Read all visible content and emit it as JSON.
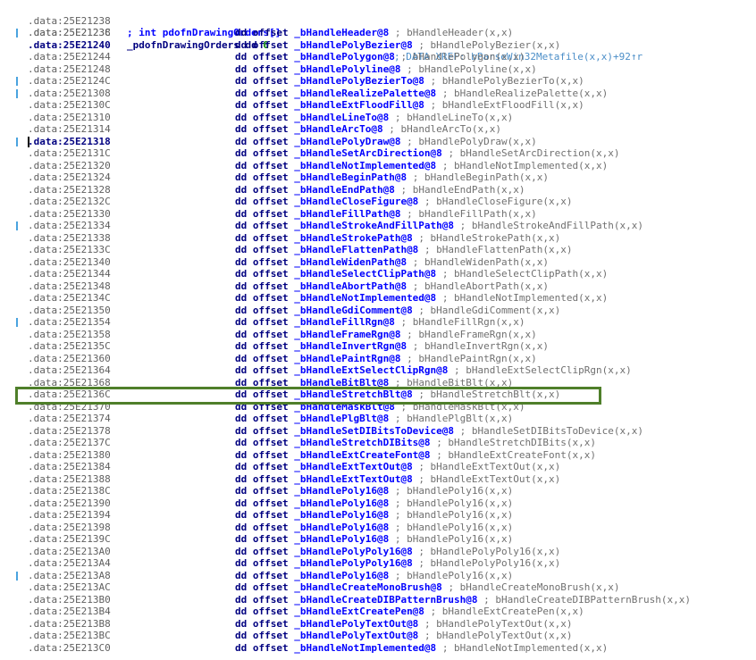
{
  "colors": {
    "address": "#606060",
    "keyword": "#000080",
    "symbol": "#0000ff",
    "comment": "#707070",
    "xref": "#4b8ec8",
    "selection_box": "#4f7f2a",
    "gutter_marker": "#4aa3df"
  },
  "header": {
    "comment_line": {
      "address": ".data:25E21238",
      "text": "; int pdofnDrawingOrders[]"
    },
    "decl_line": {
      "address": ".data:25E21238",
      "name": "_pdofnDrawingOrders",
      "directive": "dd",
      "value": "0",
      "xref": "; DATA XREF: bParseWin32Metafile(x,x)+92↑r"
    }
  },
  "selected_row_address": ".data:25E2136C",
  "rows": [
    {
      "address": ".data:25E2123C",
      "instr": "dd offset",
      "symbol": "_bHandleHeader@8",
      "comment": "; bHandleHeader(x,x)"
    },
    {
      "address": ".data:25E21240",
      "instr": "dd offset",
      "symbol": "_bHandlePolyBezier@8",
      "comment": "; bHandlePolyBezier(x,x)"
    },
    {
      "address": ".data:25E21244",
      "instr": "dd offset",
      "symbol": "_bHandlePolygon@8",
      "comment": "; bHandlePolygon(x,x)"
    },
    {
      "address": ".data:25E21248",
      "instr": "dd offset",
      "symbol": "_bHandlePolyline@8",
      "comment": "; bHandlePolyline(x,x)"
    },
    {
      "address": ".data:25E2124C",
      "instr": "dd offset",
      "symbol": "_bHandlePolyBezierTo@8",
      "comment": "; bHandlePolyBezierTo(x,x)"
    },
    {
      "address": ".data:25E21308",
      "instr": "dd offset",
      "symbol": "_bHandleRealizePalette@8",
      "comment": "; bHandleRealizePalette(x,x)"
    },
    {
      "address": ".data:25E2130C",
      "instr": "dd offset",
      "symbol": "_bHandleExtFloodFill@8",
      "comment": "; bHandleExtFloodFill(x,x)"
    },
    {
      "address": ".data:25E21310",
      "instr": "dd offset",
      "symbol": "_bHandleLineTo@8",
      "comment": "; bHandleLineTo(x,x)"
    },
    {
      "address": ".data:25E21314",
      "instr": "dd offset",
      "symbol": "_bHandleArcTo@8",
      "comment": "; bHandleArcTo(x,x)"
    },
    {
      "address": ".data:25E21318",
      "instr": "dd offset",
      "symbol": "_bHandlePolyDraw@8",
      "comment": "; bHandlePolyDraw(x,x)"
    },
    {
      "address": ".data:25E2131C",
      "instr": "dd offset",
      "symbol": "_bHandleSetArcDirection@8",
      "comment": "; bHandleSetArcDirection(x,x)"
    },
    {
      "address": ".data:25E21320",
      "instr": "dd offset",
      "symbol": "_bHandleNotImplemented@8",
      "comment": "; bHandleNotImplemented(x,x)"
    },
    {
      "address": ".data:25E21324",
      "instr": "dd offset",
      "symbol": "_bHandleBeginPath@8",
      "comment": "; bHandleBeginPath(x,x)"
    },
    {
      "address": ".data:25E21328",
      "instr": "dd offset",
      "symbol": "_bHandleEndPath@8",
      "comment": "; bHandleEndPath(x,x)"
    },
    {
      "address": ".data:25E2132C",
      "instr": "dd offset",
      "symbol": "_bHandleCloseFigure@8",
      "comment": "; bHandleCloseFigure(x,x)"
    },
    {
      "address": ".data:25E21330",
      "instr": "dd offset",
      "symbol": "_bHandleFillPath@8",
      "comment": "; bHandleFillPath(x,x)"
    },
    {
      "address": ".data:25E21334",
      "instr": "dd offset",
      "symbol": "_bHandleStrokeAndFillPath@8",
      "comment": "; bHandleStrokeAndFillPath(x,x)"
    },
    {
      "address": ".data:25E21338",
      "instr": "dd offset",
      "symbol": "_bHandleStrokePath@8",
      "comment": "; bHandleStrokePath(x,x)"
    },
    {
      "address": ".data:25E2133C",
      "instr": "dd offset",
      "symbol": "_bHandleFlattenPath@8",
      "comment": "; bHandleFlattenPath(x,x)"
    },
    {
      "address": ".data:25E21340",
      "instr": "dd offset",
      "symbol": "_bHandleWidenPath@8",
      "comment": "; bHandleWidenPath(x,x)"
    },
    {
      "address": ".data:25E21344",
      "instr": "dd offset",
      "symbol": "_bHandleSelectClipPath@8",
      "comment": "; bHandleSelectClipPath(x,x)"
    },
    {
      "address": ".data:25E21348",
      "instr": "dd offset",
      "symbol": "_bHandleAbortPath@8",
      "comment": "; bHandleAbortPath(x,x)"
    },
    {
      "address": ".data:25E2134C",
      "instr": "dd offset",
      "symbol": "_bHandleNotImplemented@8",
      "comment": "; bHandleNotImplemented(x,x)"
    },
    {
      "address": ".data:25E21350",
      "instr": "dd offset",
      "symbol": "_bHandleGdiComment@8",
      "comment": "; bHandleGdiComment(x,x)"
    },
    {
      "address": ".data:25E21354",
      "instr": "dd offset",
      "symbol": "_bHandleFillRgn@8",
      "comment": "; bHandleFillRgn(x,x)"
    },
    {
      "address": ".data:25E21358",
      "instr": "dd offset",
      "symbol": "_bHandleFrameRgn@8",
      "comment": "; bHandleFrameRgn(x,x)"
    },
    {
      "address": ".data:25E2135C",
      "instr": "dd offset",
      "symbol": "_bHandleInvertRgn@8",
      "comment": "; bHandleInvertRgn(x,x)"
    },
    {
      "address": ".data:25E21360",
      "instr": "dd offset",
      "symbol": "_bHandlePaintRgn@8",
      "comment": "; bHandlePaintRgn(x,x)"
    },
    {
      "address": ".data:25E21364",
      "instr": "dd offset",
      "symbol": "_bHandleExtSelectClipRgn@8",
      "comment": "; bHandleExtSelectClipRgn(x,x)"
    },
    {
      "address": ".data:25E21368",
      "instr": "dd offset",
      "symbol": "_bHandleBitBlt@8",
      "comment": "; bHandleBitBlt(x,x)"
    },
    {
      "address": ".data:25E2136C",
      "instr": "dd offset",
      "symbol": "_bHandleStretchBlt@8",
      "comment": "; bHandleStretchBlt(x,x)"
    },
    {
      "address": ".data:25E21370",
      "instr": "dd offset",
      "symbol": "_bHandleMaskBlt@8",
      "comment": "; bHandleMaskBlt(x,x)"
    },
    {
      "address": ".data:25E21374",
      "instr": "dd offset",
      "symbol": "_bHandlePlgBlt@8",
      "comment": "; bHandlePlgBlt(x,x)"
    },
    {
      "address": ".data:25E21378",
      "instr": "dd offset",
      "symbol": "_bHandleSetDIBitsToDevice@8",
      "comment": "; bHandleSetDIBitsToDevice(x,x)"
    },
    {
      "address": ".data:25E2137C",
      "instr": "dd offset",
      "symbol": "_bHandleStretchDIBits@8",
      "comment": "; bHandleStretchDIBits(x,x)"
    },
    {
      "address": ".data:25E21380",
      "instr": "dd offset",
      "symbol": "_bHandleExtCreateFont@8",
      "comment": "; bHandleExtCreateFont(x,x)"
    },
    {
      "address": ".data:25E21384",
      "instr": "dd offset",
      "symbol": "_bHandleExtTextOut@8",
      "comment": "; bHandleExtTextOut(x,x)"
    },
    {
      "address": ".data:25E21388",
      "instr": "dd offset",
      "symbol": "_bHandleExtTextOut@8",
      "comment": "; bHandleExtTextOut(x,x)"
    },
    {
      "address": ".data:25E2138C",
      "instr": "dd offset",
      "symbol": "_bHandlePoly16@8",
      "comment": "; bHandlePoly16(x,x)"
    },
    {
      "address": ".data:25E21390",
      "instr": "dd offset",
      "symbol": "_bHandlePoly16@8",
      "comment": "; bHandlePoly16(x,x)"
    },
    {
      "address": ".data:25E21394",
      "instr": "dd offset",
      "symbol": "_bHandlePoly16@8",
      "comment": "; bHandlePoly16(x,x)"
    },
    {
      "address": ".data:25E21398",
      "instr": "dd offset",
      "symbol": "_bHandlePoly16@8",
      "comment": "; bHandlePoly16(x,x)"
    },
    {
      "address": ".data:25E2139C",
      "instr": "dd offset",
      "symbol": "_bHandlePoly16@8",
      "comment": "; bHandlePoly16(x,x)"
    },
    {
      "address": ".data:25E213A0",
      "instr": "dd offset",
      "symbol": "_bHandlePolyPoly16@8",
      "comment": "; bHandlePolyPoly16(x,x)"
    },
    {
      "address": ".data:25E213A4",
      "instr": "dd offset",
      "symbol": "_bHandlePolyPoly16@8",
      "comment": "; bHandlePolyPoly16(x,x)"
    },
    {
      "address": ".data:25E213A8",
      "instr": "dd offset",
      "symbol": "_bHandlePoly16@8",
      "comment": "; bHandlePoly16(x,x)"
    },
    {
      "address": ".data:25E213AC",
      "instr": "dd offset",
      "symbol": "_bHandleCreateMonoBrush@8",
      "comment": "; bHandleCreateMonoBrush(x,x)"
    },
    {
      "address": ".data:25E213B0",
      "instr": "dd offset",
      "symbol": "_bHandleCreateDIBPatternBrush@8",
      "comment": "; bHandleCreateDIBPatternBrush(x,x)"
    },
    {
      "address": ".data:25E213B4",
      "instr": "dd offset",
      "symbol": "_bHandleExtCreatePen@8",
      "comment": "; bHandleExtCreatePen(x,x)"
    },
    {
      "address": ".data:25E213B8",
      "instr": "dd offset",
      "symbol": "_bHandlePolyTextOut@8",
      "comment": "; bHandlePolyTextOut(x,x)"
    },
    {
      "address": ".data:25E213BC",
      "instr": "dd offset",
      "symbol": "_bHandlePolyTextOut@8",
      "comment": "; bHandlePolyTextOut(x,x)"
    },
    {
      "address": ".data:25E213C0",
      "instr": "dd offset",
      "symbol": "_bHandleNotImplemented@8",
      "comment": "; bHandleNotImplemented(x,x)"
    }
  ]
}
